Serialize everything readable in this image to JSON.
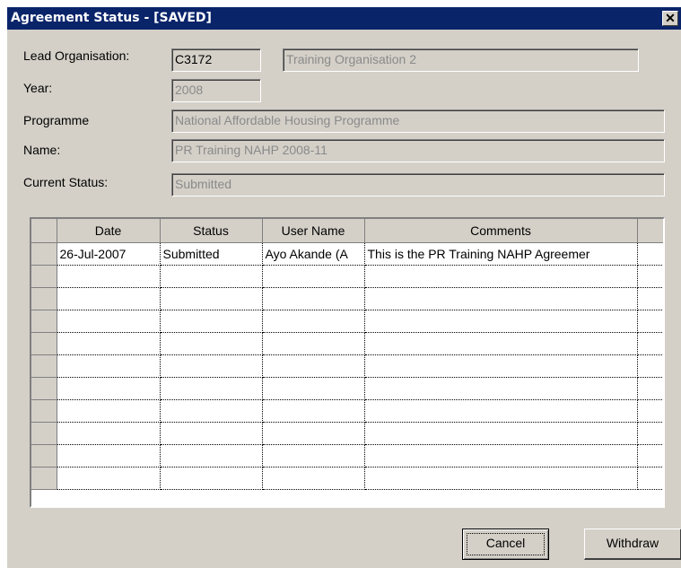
{
  "window": {
    "title": "Agreement Status - [SAVED]",
    "close_glyph": "✕"
  },
  "form": {
    "lead_organisation_label": "Lead Organisation:",
    "lead_organisation_code": "C3172",
    "lead_organisation_name": "Training Organisation 2",
    "year_label": "Year:",
    "year_value": "2008",
    "programme_label": "Programme",
    "programme_value": "National Affordable Housing Programme",
    "name_label": "Name:",
    "name_value": "PR Training NAHP 2008-11",
    "current_status_label": "Current Status:",
    "current_status_value": "Submitted"
  },
  "grid": {
    "columns": [
      "Date",
      "Status",
      "User Name",
      "Comments"
    ],
    "rows": [
      [
        "26-Jul-2007",
        "Submitted",
        "Ayo Akande (A",
        "This is the PR Training NAHP Agreemer"
      ],
      [
        "",
        "",
        "",
        ""
      ],
      [
        "",
        "",
        "",
        ""
      ],
      [
        "",
        "",
        "",
        ""
      ],
      [
        "",
        "",
        "",
        ""
      ],
      [
        "",
        "",
        "",
        ""
      ],
      [
        "",
        "",
        "",
        ""
      ],
      [
        "",
        "",
        "",
        ""
      ],
      [
        "",
        "",
        "",
        ""
      ],
      [
        "",
        "",
        "",
        ""
      ],
      [
        "",
        "",
        "",
        ""
      ]
    ]
  },
  "buttons": {
    "cancel_label": "Cancel",
    "withdraw_label": "Withdraw"
  },
  "colors": {
    "titlebar": "#0a246a",
    "face": "#d4d0c8",
    "disabled_text": "#8a8a8a"
  }
}
